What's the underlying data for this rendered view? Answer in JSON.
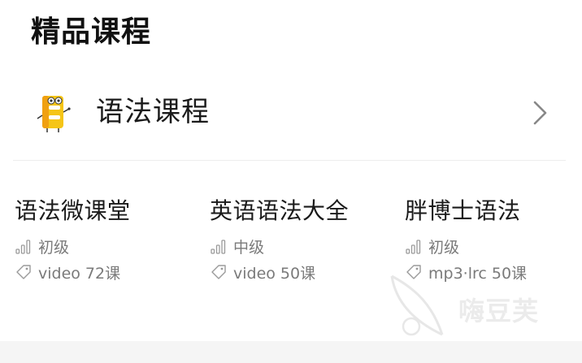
{
  "section": {
    "title": "精品课程"
  },
  "category": {
    "label": "语法课程",
    "icon": "grammar-book-mascot-icon",
    "chevron_icon": "chevron-right-icon"
  },
  "courses": [
    {
      "title": "语法微课堂",
      "level": "初级",
      "tag": "video 72课"
    },
    {
      "title": "英语语法大全",
      "level": "中级",
      "tag": "video 50课"
    },
    {
      "title": "胖博士语法",
      "level": "初级",
      "tag": "mp3·lrc 50课"
    }
  ],
  "watermark": {
    "text": "嗨豆芙"
  },
  "colors": {
    "accent_yellow": "#f5c518",
    "accent_orange": "#f0a010",
    "text_primary": "#1a1a1a",
    "text_secondary": "#7a7a7a"
  }
}
